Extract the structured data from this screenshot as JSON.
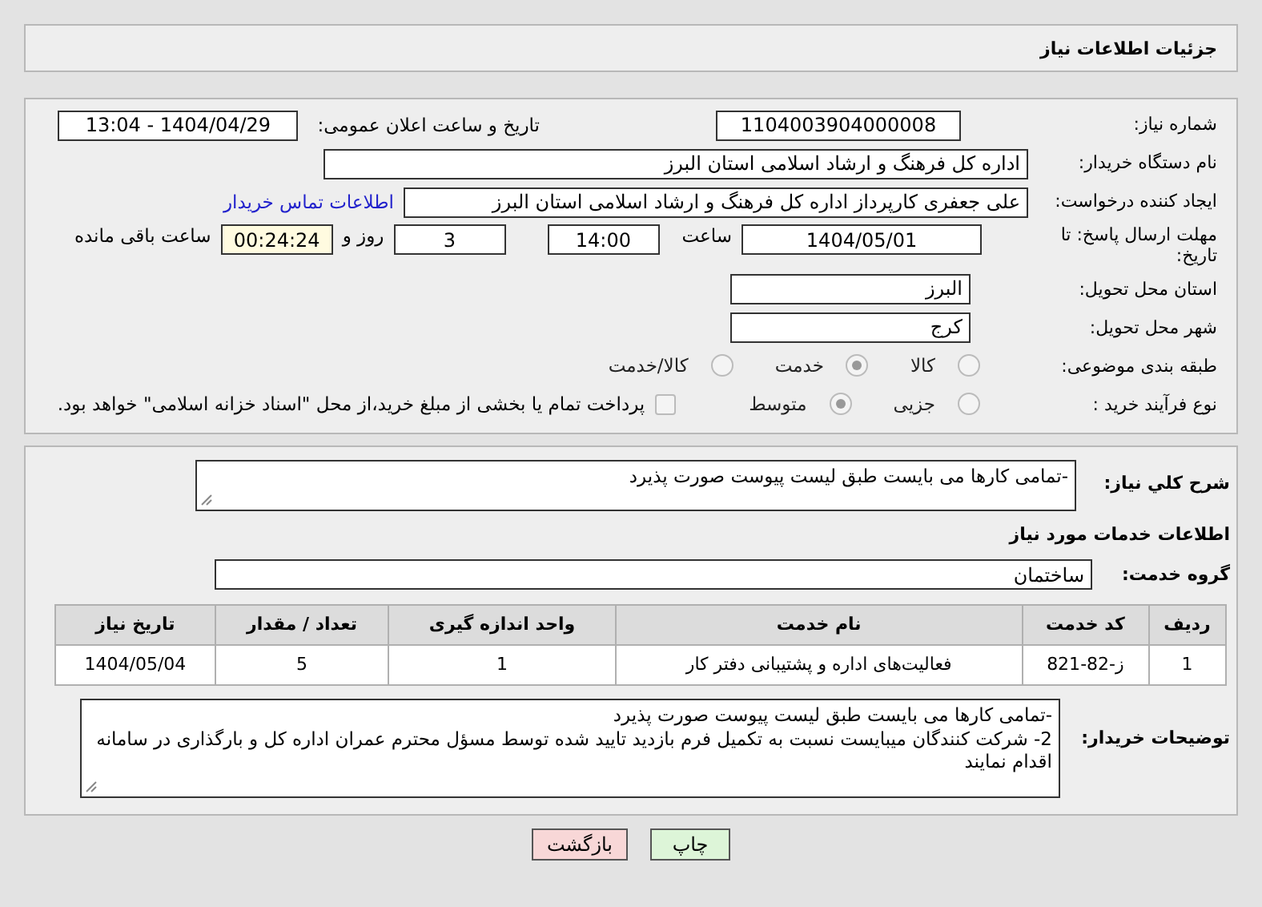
{
  "header": {
    "title": "جزئیات اطلاعات نیاز"
  },
  "need": {
    "number_label": "شماره نیاز:",
    "number": "1104003904000008",
    "announce_label": "تاریخ و ساعت اعلان عمومی:",
    "announce": "1404/04/29 - 13:04",
    "buyer_label": "نام دستگاه خریدار:",
    "buyer": "اداره کل فرهنگ و ارشاد اسلامی استان البرز",
    "creator_label": "ایجاد کننده درخواست:",
    "creator": "علی جعفری کارپرداز اداره کل فرهنگ و ارشاد اسلامی استان البرز",
    "contact_link": "اطلاعات تماس خریدار",
    "deadline_label": "مهلت ارسال پاسخ: تا تاریخ:",
    "deadline_date": "1404/05/01",
    "time_label": "ساعت",
    "deadline_time": "14:00",
    "days": "3",
    "days_label": "روز و",
    "remaining": "00:24:24",
    "remaining_label": "ساعت باقی مانده",
    "province_label": "استان محل تحویل:",
    "province": "البرز",
    "city_label": "شهر محل تحویل:",
    "city": "کرج",
    "category_label": "طبقه بندی موضوعی:",
    "categories": [
      {
        "label": "کالا",
        "selected": false
      },
      {
        "label": "خدمت",
        "selected": true
      },
      {
        "label": "کالا/خدمت",
        "selected": false
      }
    ],
    "process_label": "نوع فرآیند خرید :",
    "processes": [
      {
        "label": "جزیی",
        "selected": false
      },
      {
        "label": "متوسط",
        "selected": true
      }
    ],
    "payment": {
      "label": "پرداخت تمام یا بخشی از مبلغ خرید،از محل \"اسناد خزانه اسلامی\" خواهد بود.",
      "checked": false
    }
  },
  "services": {
    "summary_label": "شرح کلي نیاز:",
    "summary": "-تمامی کارها می بایست طبق لیست پیوست صورت پذیرد",
    "section_title": "اطلاعات خدمات مورد نیاز",
    "group_label": "گروه خدمت:",
    "group": "ساختمان",
    "table": {
      "columns": [
        "ردیف",
        "کد خدمت",
        "نام خدمت",
        "واحد اندازه گیری",
        "تعداد / مقدار",
        "تاریخ نیاز"
      ],
      "rows": [
        [
          "1",
          "ز-82-821",
          "فعالیت‌های اداره و پشتیبانی دفتر کار",
          "1",
          "5",
          "1404/05/04"
        ]
      ]
    },
    "notes_label": "توضیحات خریدار:",
    "notes": [
      "-تمامی کارها می بایست طبق لیست پیوست صورت پذیرد",
      "2- شرکت کنندگان میبایست نسبت به تکمیل فرم بازدید تایید شده توسط مسؤل محترم عمران اداره کل و بارگذاری در سامانه اقدام نمایند"
    ]
  },
  "buttons": [
    {
      "kind": "print",
      "label": "چاپ"
    },
    {
      "kind": "back",
      "label": "بازگشت"
    }
  ]
}
